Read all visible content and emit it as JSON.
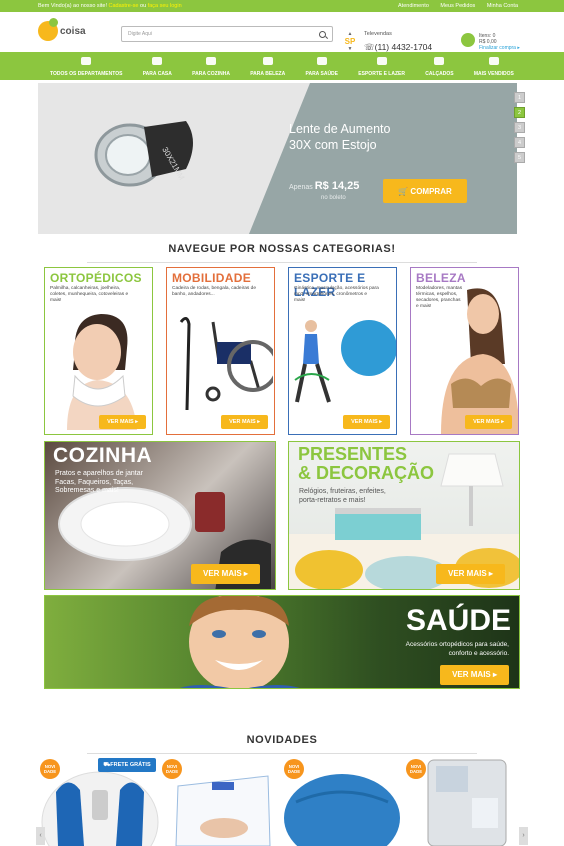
{
  "topbar": {
    "welcome": "Bem Vindo(a) ao nosso site!",
    "signup": "Cadastre-se",
    "or": "ou",
    "login": "faça seu login",
    "links": [
      "Atendimento",
      "Meus Pedidos",
      "Minha Conta"
    ]
  },
  "header": {
    "logo_text": "coisa",
    "search_placeholder": "Digite Aqui",
    "state": "SP",
    "phone_label": "Televendas",
    "phone": "(11) 4432-1704",
    "cart_items": "Itens: 0",
    "cart_total": "R$ 0,00",
    "cart_finish": "Finalizar compra"
  },
  "nav": [
    "TODOS OS DEPARTAMENTOS",
    "PARA CASA",
    "PARA COZINHA",
    "PARA BELEZA",
    "PARA SAÚDE",
    "ESPORTE E LAZER",
    "CALÇADOS",
    "MAIS VENDIDOS"
  ],
  "banner": {
    "title_line1": "Lente de Aumento",
    "title_line2": "30X com Estojo",
    "price_prefix": "Apenas",
    "price": "R$ 14,25",
    "price_note": "no boleto",
    "buy_label": "COMPRAR",
    "lens_text": "30X21MM",
    "slides": [
      "1",
      "2",
      "3",
      "4",
      "5"
    ]
  },
  "categories_title": "NAVEGUE POR NOSSAS CATEGORIAS!",
  "cards": [
    {
      "title": "ORTOPÉDICOS",
      "desc": "Palmilha, calcanheiras, joelheira, coletes, munhequeira, cotoveleiras e mais!",
      "color": "#8cc63f",
      "button": "VER MAIS"
    },
    {
      "title": "MOBILIDADE",
      "desc": "Cadeira de rodas, bengala, cadeiras de banho, andadores...",
      "color": "#e36f3b",
      "button": "VER MAIS"
    },
    {
      "title": "ESPORTE E LAZER",
      "desc": "Ginástica, musculação, acessórios para mp3, smartphones, cronômetros e mais!",
      "color": "#3a6fb7",
      "button": "VER MAIS"
    },
    {
      "title": "BELEZA",
      "desc": "Modeladores, mantas térmicas, espelhos, secadores, pranchas e mais!",
      "color": "#a779c4",
      "button": "VER MAIS"
    }
  ],
  "cozinha": {
    "title": "COZINHA",
    "desc_lines": [
      "Pratos e aparelhos de jantar",
      "Facas, Faqueiros, Taças,",
      "Sobremesas e mais!"
    ],
    "button": "VER MAIS"
  },
  "presentes": {
    "title_line1": "PRESENTES",
    "title_line2": "& DECORAÇÃO",
    "desc_lines": [
      "Relógios, fruteiras, enfeites,",
      "porta-retratos e mais!"
    ],
    "button": "VER MAIS"
  },
  "saude": {
    "title": "SAÚDE",
    "desc_lines": [
      "Acessórios ortopédicos para saúde,",
      "conforto e acessório."
    ],
    "button": "VER MAIS"
  },
  "novidades_title": "NOVIDADES",
  "novidades": {
    "badge": "NOVI DADE",
    "frete": "FRETE GRÁTIS"
  }
}
